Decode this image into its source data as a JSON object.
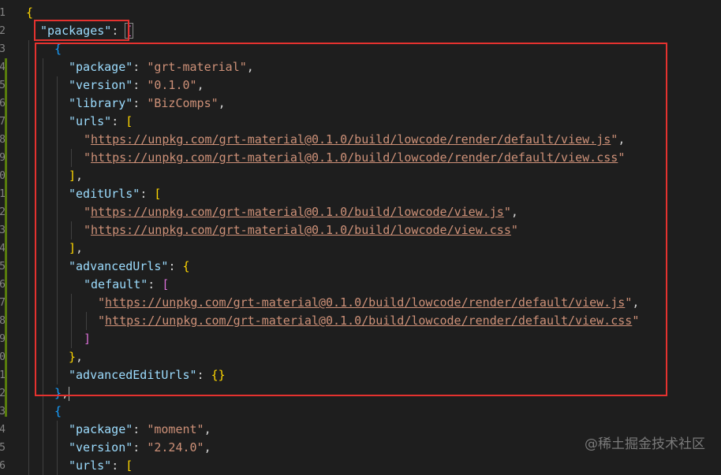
{
  "gutter": [
    "1",
    "2",
    "3",
    "4",
    "5",
    "6",
    "7",
    "8",
    "9",
    "0",
    "1",
    "2",
    "3",
    "4",
    "5",
    "6",
    "7",
    "8",
    "9",
    "0",
    "1",
    "2",
    "3",
    "4",
    "5",
    "6"
  ],
  "lines": [
    {
      "indent": 1,
      "tokens": [
        {
          "t": "{",
          "c": "b1"
        }
      ]
    },
    {
      "indent": 2,
      "tokens": [
        {
          "t": "\"packages\"",
          "c": "k"
        },
        {
          "t": ": ",
          "c": "p"
        },
        {
          "t": "[",
          "c": "b2 bm"
        }
      ]
    },
    {
      "indent": 3,
      "tokens": [
        {
          "t": "{",
          "c": "b3"
        }
      ]
    },
    {
      "indent": 4,
      "tokens": [
        {
          "t": "\"package\"",
          "c": "k"
        },
        {
          "t": ": ",
          "c": "p"
        },
        {
          "t": "\"grt-material\"",
          "c": "s"
        },
        {
          "t": ",",
          "c": "p"
        }
      ]
    },
    {
      "indent": 4,
      "tokens": [
        {
          "t": "\"version\"",
          "c": "k"
        },
        {
          "t": ": ",
          "c": "p"
        },
        {
          "t": "\"0.1.0\"",
          "c": "s"
        },
        {
          "t": ",",
          "c": "p"
        }
      ]
    },
    {
      "indent": 4,
      "tokens": [
        {
          "t": "\"library\"",
          "c": "k"
        },
        {
          "t": ": ",
          "c": "p"
        },
        {
          "t": "\"BizComps\"",
          "c": "s"
        },
        {
          "t": ",",
          "c": "p"
        }
      ]
    },
    {
      "indent": 4,
      "tokens": [
        {
          "t": "\"urls\"",
          "c": "k"
        },
        {
          "t": ": ",
          "c": "p"
        },
        {
          "t": "[",
          "c": "b1"
        }
      ]
    },
    {
      "indent": 5,
      "tokens": [
        {
          "t": "\"",
          "c": "s"
        },
        {
          "t": "https://unpkg.com/grt-material@0.1.0/build/lowcode/render/default/view.js",
          "c": "s u"
        },
        {
          "t": "\"",
          "c": "s"
        },
        {
          "t": ",",
          "c": "p"
        }
      ]
    },
    {
      "indent": 5,
      "tokens": [
        {
          "t": "\"",
          "c": "s"
        },
        {
          "t": "https://unpkg.com/grt-material@0.1.0/build/lowcode/render/default/view.css",
          "c": "s u"
        },
        {
          "t": "\"",
          "c": "s"
        }
      ]
    },
    {
      "indent": 4,
      "tokens": [
        {
          "t": "]",
          "c": "b1"
        },
        {
          "t": ",",
          "c": "p"
        }
      ]
    },
    {
      "indent": 4,
      "tokens": [
        {
          "t": "\"editUrls\"",
          "c": "k"
        },
        {
          "t": ": ",
          "c": "p"
        },
        {
          "t": "[",
          "c": "b1"
        }
      ]
    },
    {
      "indent": 5,
      "tokens": [
        {
          "t": "\"",
          "c": "s"
        },
        {
          "t": "https://unpkg.com/grt-material@0.1.0/build/lowcode/view.js",
          "c": "s u"
        },
        {
          "t": "\"",
          "c": "s"
        },
        {
          "t": ",",
          "c": "p"
        }
      ]
    },
    {
      "indent": 5,
      "tokens": [
        {
          "t": "\"",
          "c": "s"
        },
        {
          "t": "https://unpkg.com/grt-material@0.1.0/build/lowcode/view.css",
          "c": "s u"
        },
        {
          "t": "\"",
          "c": "s"
        }
      ]
    },
    {
      "indent": 4,
      "tokens": [
        {
          "t": "]",
          "c": "b1"
        },
        {
          "t": ",",
          "c": "p"
        }
      ]
    },
    {
      "indent": 4,
      "tokens": [
        {
          "t": "\"advancedUrls\"",
          "c": "k"
        },
        {
          "t": ": ",
          "c": "p"
        },
        {
          "t": "{",
          "c": "b1"
        }
      ]
    },
    {
      "indent": 5,
      "tokens": [
        {
          "t": "\"default\"",
          "c": "k"
        },
        {
          "t": ": ",
          "c": "p"
        },
        {
          "t": "[",
          "c": "b2"
        }
      ]
    },
    {
      "indent": 6,
      "tokens": [
        {
          "t": "\"",
          "c": "s"
        },
        {
          "t": "https://unpkg.com/grt-material@0.1.0/build/lowcode/render/default/view.js",
          "c": "s u"
        },
        {
          "t": "\"",
          "c": "s"
        },
        {
          "t": ",",
          "c": "p"
        }
      ]
    },
    {
      "indent": 6,
      "tokens": [
        {
          "t": "\"",
          "c": "s"
        },
        {
          "t": "https://unpkg.com/grt-material@0.1.0/build/lowcode/render/default/view.css",
          "c": "s u"
        },
        {
          "t": "\"",
          "c": "s"
        }
      ]
    },
    {
      "indent": 5,
      "tokens": [
        {
          "t": "]",
          "c": "b2"
        }
      ]
    },
    {
      "indent": 4,
      "tokens": [
        {
          "t": "}",
          "c": "b1"
        },
        {
          "t": ",",
          "c": "p"
        }
      ]
    },
    {
      "indent": 4,
      "tokens": [
        {
          "t": "\"advancedEditUrls\"",
          "c": "k"
        },
        {
          "t": ": ",
          "c": "p"
        },
        {
          "t": "{}",
          "c": "b1"
        }
      ]
    },
    {
      "indent": 3,
      "tokens": [
        {
          "t": "}",
          "c": "b3"
        },
        {
          "t": ",",
          "c": "p"
        }
      ]
    },
    {
      "indent": 3,
      "tokens": [
        {
          "t": "{",
          "c": "b3"
        }
      ]
    },
    {
      "indent": 4,
      "tokens": [
        {
          "t": "\"package\"",
          "c": "k"
        },
        {
          "t": ": ",
          "c": "p"
        },
        {
          "t": "\"moment\"",
          "c": "s"
        },
        {
          "t": ",",
          "c": "p"
        }
      ]
    },
    {
      "indent": 4,
      "tokens": [
        {
          "t": "\"version\"",
          "c": "k"
        },
        {
          "t": ": ",
          "c": "p"
        },
        {
          "t": "\"2.24.0\"",
          "c": "s"
        },
        {
          "t": ",",
          "c": "p"
        }
      ]
    },
    {
      "indent": 4,
      "tokens": [
        {
          "t": "\"urls\"",
          "c": "k"
        },
        {
          "t": ": ",
          "c": "p"
        },
        {
          "t": "[",
          "c": "b1"
        }
      ]
    }
  ],
  "watermark": "@稀土掘金技术社区",
  "colors": {
    "background": "#1e1e1e",
    "highlight_box": "#e5322f",
    "key": "#9cdcfe",
    "string": "#ce9178",
    "bracket_gold": "#ffd700",
    "bracket_pink": "#da70d6",
    "bracket_blue": "#179fff",
    "git_added": "#587c0c"
  }
}
